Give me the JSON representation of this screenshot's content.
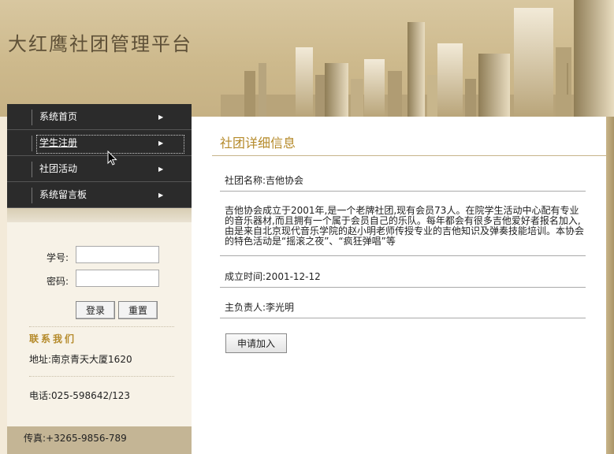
{
  "header": {
    "site_title": "大红鹰社团管理平台"
  },
  "nav": {
    "items": [
      {
        "label": "系统首页"
      },
      {
        "label": "学生注册"
      },
      {
        "label": "社团活动"
      },
      {
        "label": "系统留言板"
      }
    ],
    "active_index": 1
  },
  "login": {
    "student_id_label": "学号:",
    "password_label": "密码:",
    "student_id_value": "",
    "password_value": "",
    "login_button": "登录",
    "reset_button": "重置"
  },
  "contact": {
    "title": "联系我们",
    "address": "地址:南京青天大厦1620",
    "phone": "电话:025-598642/123",
    "fax": "传真:+3265-9856-789"
  },
  "detail": {
    "title": "社团详细信息",
    "name": "社团名称:吉他协会",
    "description": "吉他协会成立于2001年,是一个老牌社团,现有会员73人。在院学生活动中心配有专业的音乐器材,而且拥有一个属于会员自己的乐队。每年都会有很多吉他爱好者报名加入,由是来自北京现代音乐学院的赵小明老师传授专业的吉他知识及弹奏技能培训。本协会的特色活动是“摇滚之夜”、“疯狂弹唱”等",
    "founded": "成立时间:2001-12-12",
    "leader": "主负责人:李光明",
    "apply_button": "申请加入"
  },
  "colors": {
    "accent": "#b58a2a",
    "nav_bg": "#2b2b2b",
    "header_bg": "#cdb98c"
  }
}
